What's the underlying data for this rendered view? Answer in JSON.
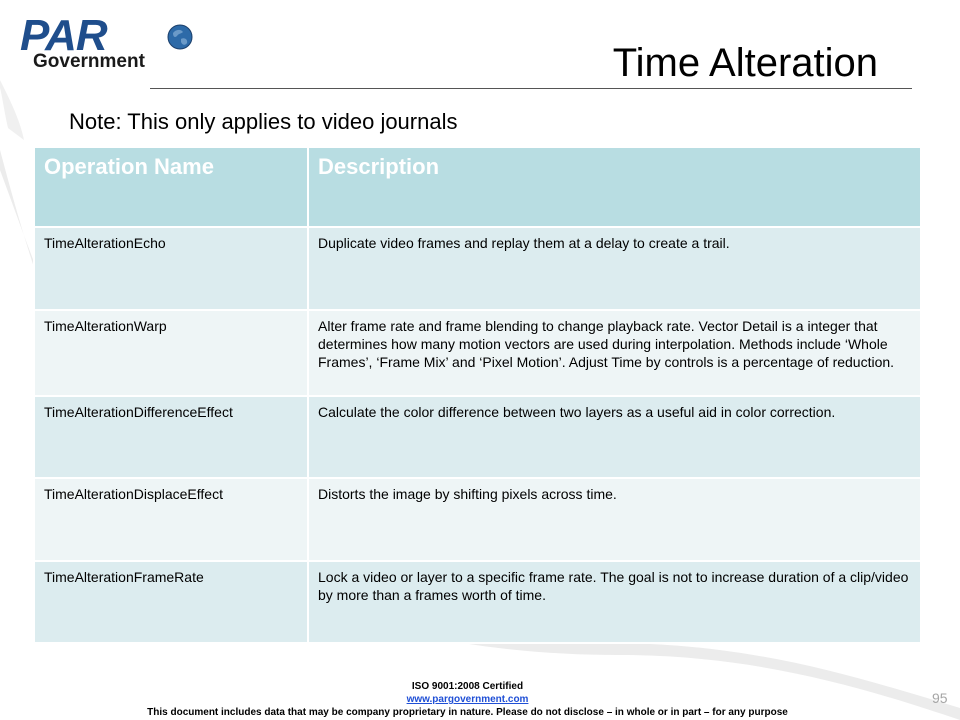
{
  "logo": {
    "brand_top": "PAR",
    "brand_bottom": "Government"
  },
  "slide": {
    "title": "Time Alteration",
    "note": "Note: This only applies to video journals"
  },
  "table": {
    "headers": [
      "Operation Name",
      "Description"
    ],
    "rows": [
      {
        "name": "TimeAlterationEcho",
        "description": "Duplicate video frames and replay them at a delay to create a trail."
      },
      {
        "name": "TimeAlterationWarp",
        "description": "Alter frame rate and frame blending to change playback rate.  Vector Detail is a integer that determines how many motion vectors are used during interpolation. Methods include ‘Whole Frames’, ‘Frame Mix’ and ‘Pixel Motion’. Adjust Time by controls is a percentage of reduction."
      },
      {
        "name": "TimeAlterationDifferenceEffect",
        "description": "Calculate the color difference between two layers as a useful aid in color correction."
      },
      {
        "name": "TimeAlterationDisplaceEffect",
        "description": "Distorts the image by shifting pixels across time."
      },
      {
        "name": "TimeAlterationFrameRate",
        "description": "Lock a video or layer to a specific frame rate. The goal is not to increase duration of a clip/video by more than a frames worth of time."
      }
    ]
  },
  "footer": {
    "certification": "ISO 9001:2008 Certified",
    "website": "www.pargovernment.com",
    "disclaimer": "This document includes data that may be company proprietary in nature. Please do not disclose – in whole or in part – for any purpose"
  },
  "page_number": "95",
  "colors": {
    "header_fill": "#b8dde2",
    "row_fill_a": "#dcecef",
    "row_fill_b": "#eef5f6",
    "brand_blue": "#1f4e8c",
    "link_blue": "#1f4fd6"
  }
}
